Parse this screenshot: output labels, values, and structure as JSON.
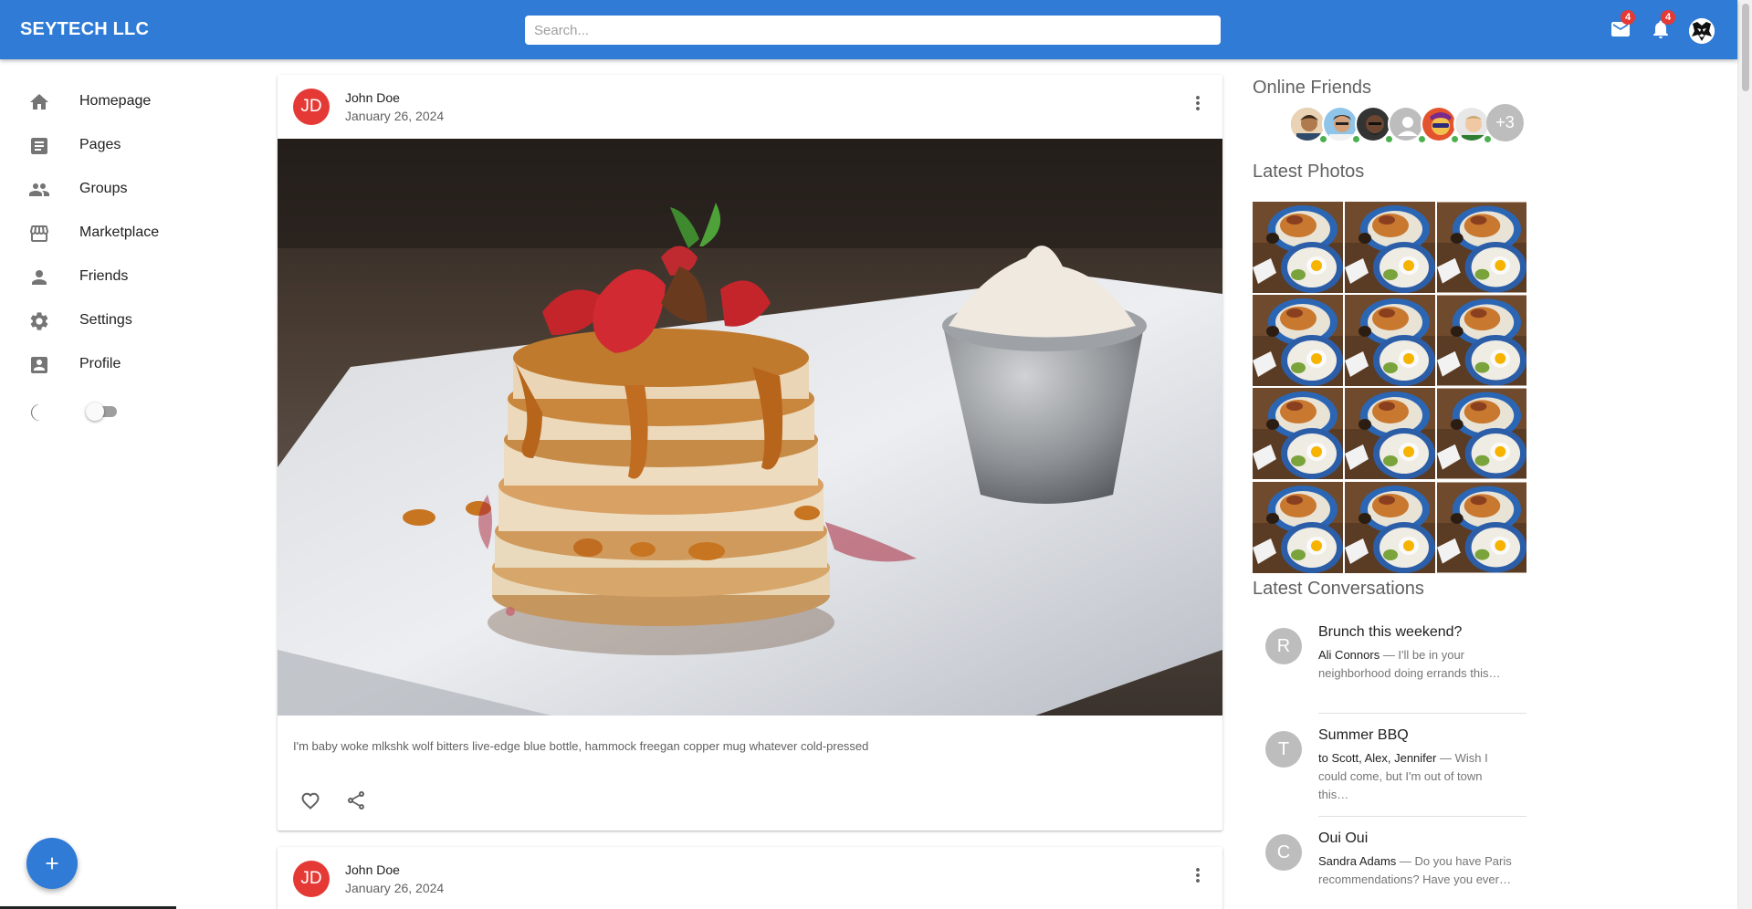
{
  "appbar": {
    "brand": "SEYTECH LLC",
    "search_placeholder": "Search...",
    "mail_badge": "4",
    "notifications_badge": "4",
    "color": "#2f7bd5"
  },
  "sidebar": {
    "items": [
      {
        "label": "Homepage",
        "icon": "home-icon"
      },
      {
        "label": "Pages",
        "icon": "article-icon"
      },
      {
        "label": "Groups",
        "icon": "groups-icon"
      },
      {
        "label": "Marketplace",
        "icon": "storefront-icon"
      },
      {
        "label": "Friends",
        "icon": "person-icon"
      },
      {
        "label": "Settings",
        "icon": "gear-icon"
      },
      {
        "label": "Profile",
        "icon": "account-box-icon"
      }
    ],
    "dark_mode_enabled": false,
    "fab_icon": "plus-icon"
  },
  "feed": {
    "posts": [
      {
        "avatar_initials": "JD",
        "author": "John Doe",
        "date": "January 26, 2024",
        "text": "I'm baby woke mlkshk wolf bitters live-edge blue bottle, hammock freegan copper mug whatever cold-pressed"
      },
      {
        "avatar_initials": "JD",
        "author": "John Doe",
        "date": "January 26, 2024"
      }
    ]
  },
  "rightpanel": {
    "online_friends_title": "Online Friends",
    "online_friends_more": "+3",
    "latest_photos_title": "Latest Photos",
    "latest_conversations_title": "Latest Conversations",
    "conversations": [
      {
        "initial": "R",
        "title": "Brunch this weekend?",
        "from": "Ali Connors",
        "snippet": " — I'll be in your neighborhood doing errands this…"
      },
      {
        "initial": "T",
        "title": "Summer BBQ",
        "from": "to Scott, Alex, Jennifer",
        "snippet": " — Wish I could come, but I'm out of town this…"
      },
      {
        "initial": "C",
        "title": "Oui Oui",
        "from": "Sandra Adams",
        "snippet": " — Do you have Paris recommendations? Have you ever…"
      }
    ]
  }
}
